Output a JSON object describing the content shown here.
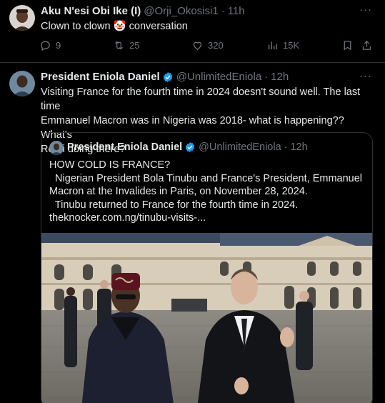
{
  "tweet1": {
    "author_name": "Aku N'esi Obi Ike (I)",
    "handle": "@Orji_Okosisi1",
    "separator": "·",
    "time": "11h",
    "text": "Clown to clown",
    "emoji": "🤡",
    "text_after": "conversation",
    "more_label": "···",
    "replies": "9",
    "reposts": "25",
    "likes": "320",
    "views": "15K"
  },
  "tweet2": {
    "author_name": "President Eniola Daniel",
    "handle": "@UnlimitedEniola",
    "separator": "·",
    "time": "12h",
    "more_label": "···",
    "text_lines": [
      "Visiting France for the fourth time in 2024 doesn't sound well. The last time",
      "Emmanuel Macron was in Nigeria was 2018- what is happening?? What's",
      "Remi doing there?"
    ]
  },
  "quote": {
    "author_name": "President Eniola Daniel",
    "handle": "@UnlimitedEniola",
    "separator": "·",
    "time": "12h",
    "lines": [
      "HOW COLD IS FRANCE?",
      "  Nigerian President Bola Tinubu and France's President, Emmanuel",
      "Macron at the Invalides in Paris, on November 28, 2024.",
      "  Tinubu returned to France for the fourth time in 2024.",
      "theknocker.com.ng/tinubu-visits-..."
    ]
  },
  "colors": {
    "background": "#000000",
    "text": "#e7e9ea",
    "muted": "#71767b",
    "verified": "#1d9bf0",
    "border": "#2f3336"
  },
  "icons": [
    "reply-icon",
    "repost-icon",
    "like-icon",
    "views-icon",
    "bookmark-icon",
    "share-icon",
    "verified-badge-icon",
    "more-icon"
  ]
}
